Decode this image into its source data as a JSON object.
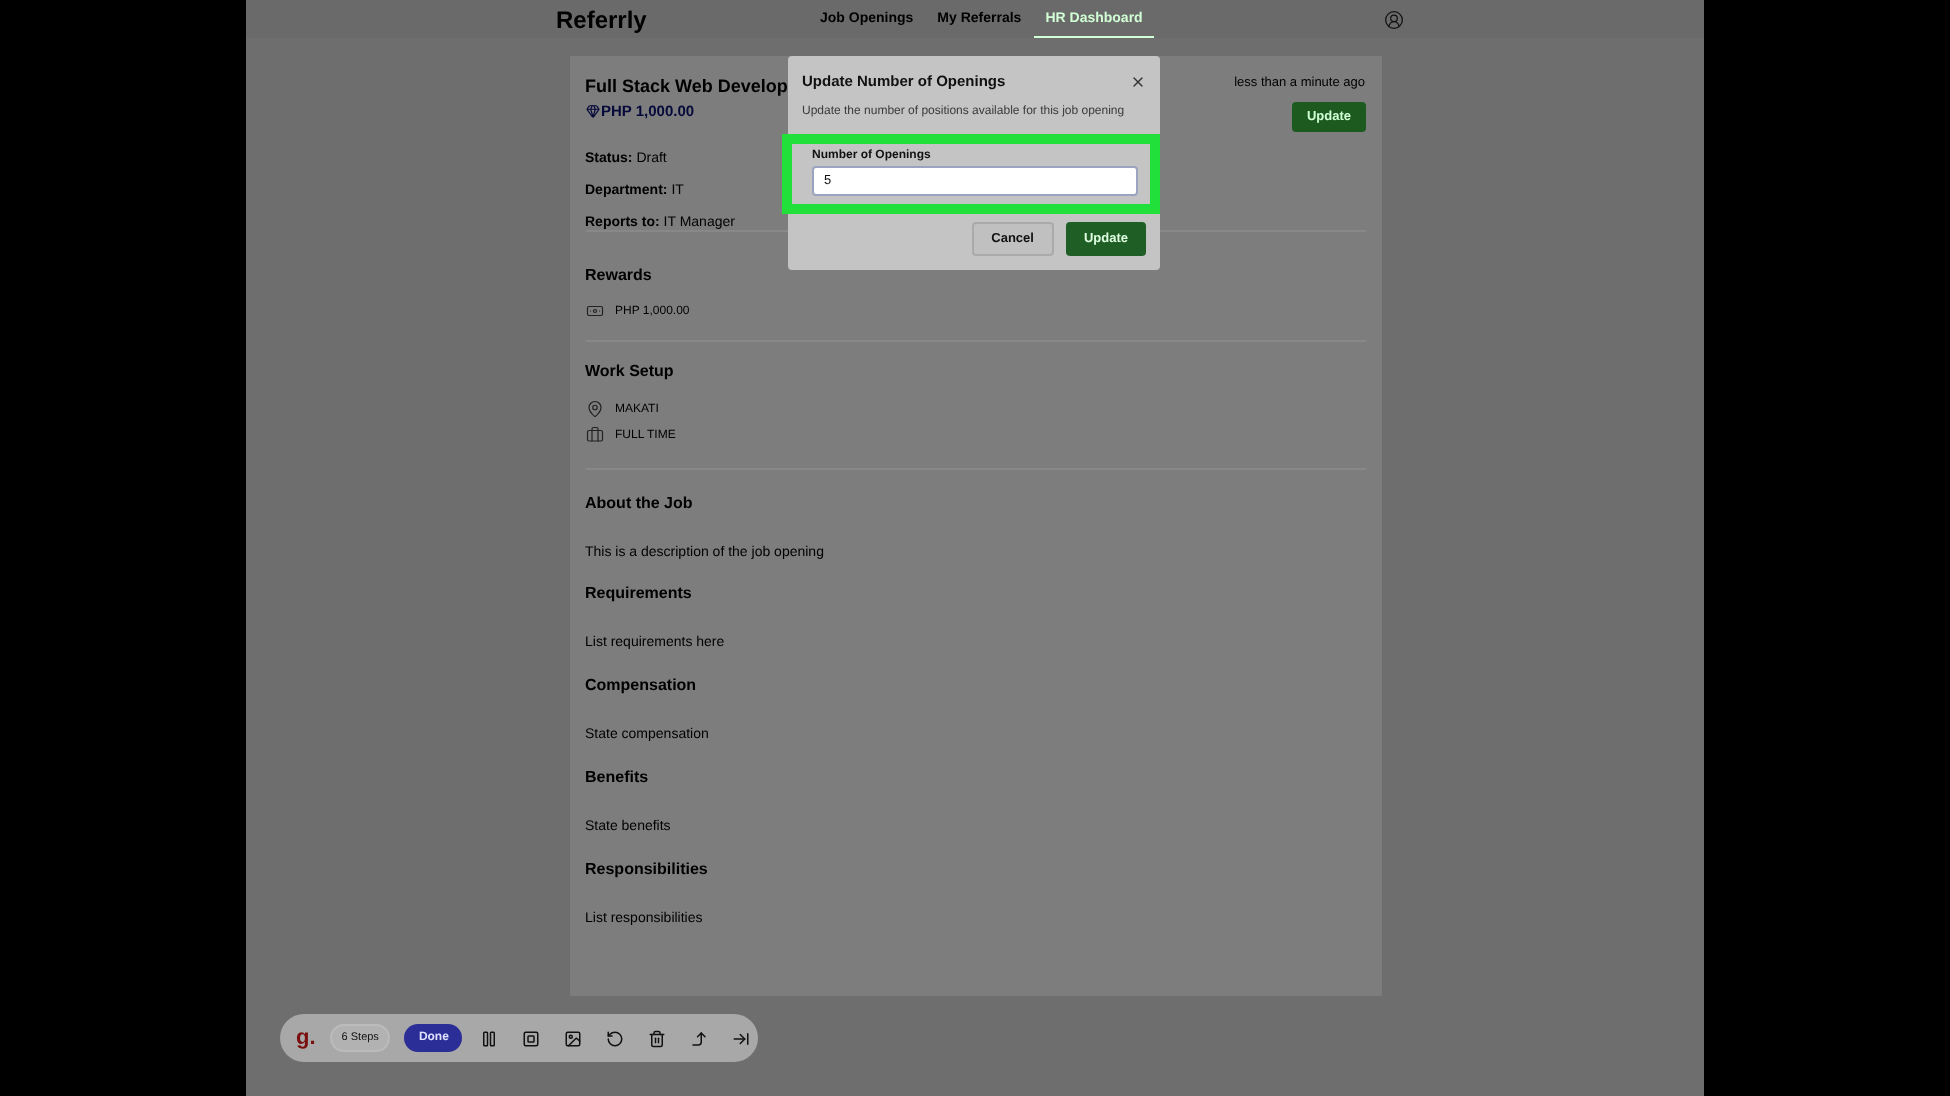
{
  "nav": {
    "brand": "Referrly",
    "links": [
      {
        "label": "Job Openings",
        "selected": false
      },
      {
        "label": "My Referrals",
        "selected": false
      },
      {
        "label": "HR Dashboard",
        "selected": true
      }
    ]
  },
  "job": {
    "title": "Full Stack Web Develop",
    "reward": "PHP 1,000.00",
    "updated": "less than a minute ago",
    "update_button": "Update",
    "fields": [
      {
        "label": "Status:",
        "value": "Draft"
      },
      {
        "label": "Department:",
        "value": "IT"
      },
      {
        "label": "Reports to:",
        "value": "IT Manager"
      }
    ],
    "rewards": {
      "heading": "Rewards",
      "items": [
        {
          "kind": "money",
          "text": "PHP 1,000.00"
        }
      ]
    },
    "work_setup": {
      "heading": "Work Setup",
      "items": [
        {
          "kind": "location",
          "text": "MAKATI"
        },
        {
          "kind": "briefcase",
          "text": "FULL TIME"
        }
      ]
    },
    "sections": [
      {
        "heading": "About the Job",
        "text": "This is a description of the job opening"
      },
      {
        "heading": "Requirements",
        "text": "List requirements here"
      },
      {
        "heading": "Compensation",
        "text": "State compensation"
      },
      {
        "heading": "Benefits",
        "text": "State benefits"
      },
      {
        "heading": "Responsibilities",
        "text": "List responsibilities"
      }
    ]
  },
  "modal": {
    "title": "Update Number of Openings",
    "description": "Update the number of positions available for this job opening",
    "field": {
      "label": "Number of Openings",
      "value": "5",
      "highlighted": true
    },
    "buttons": [
      {
        "kind": "secondary",
        "label": "Cancel"
      },
      {
        "kind": "primary",
        "label": "Update"
      }
    ]
  },
  "recorder": {
    "logo": "g.",
    "steps": "6 Steps",
    "done": "Done"
  }
}
